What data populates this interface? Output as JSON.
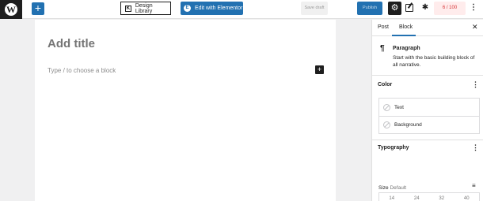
{
  "toolbar": {
    "wp_logo": "W",
    "add_label": "+",
    "design_library_label": "Design Library",
    "design_library_icon": "K",
    "elementor_label": "Edit with Elementor",
    "elementor_icon": "E",
    "save_draft_label": "Save draft",
    "publish_label": "Publish",
    "settings_icon": "⚙",
    "plugin_icon": "✱",
    "score_label": "6 / 100",
    "more_icon": "⋮"
  },
  "editor": {
    "title_placeholder": "Add title",
    "block_hint": "Type / to choose a block",
    "inline_add": "+"
  },
  "sidebar": {
    "tabs": [
      {
        "label": "Post",
        "active": false
      },
      {
        "label": "Block",
        "active": true
      }
    ],
    "close_icon": "✕",
    "block": {
      "icon": "¶",
      "name": "Paragraph",
      "description": "Start with the basic building block of all narrative."
    },
    "color": {
      "title": "Color",
      "more_icon": "⋮",
      "items": [
        {
          "label": "Text"
        },
        {
          "label": "Background"
        }
      ]
    },
    "typography": {
      "title": "Typography",
      "more_icon": "⋮",
      "size_label": "Size",
      "size_value": "Default",
      "adjust_icon": "≡",
      "size_options": [
        "14",
        "24",
        "32",
        "40"
      ]
    }
  },
  "colors": {
    "accent": "#2271b1",
    "dark": "#1e1e1e",
    "score_text": "#d63638"
  }
}
